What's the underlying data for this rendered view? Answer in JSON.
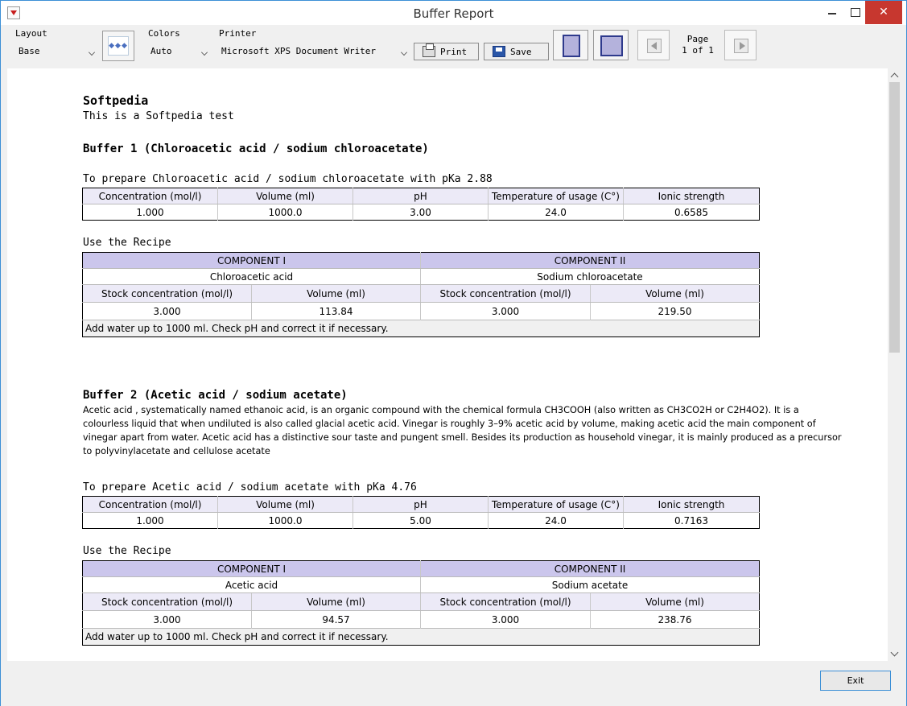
{
  "window": {
    "title": "Buffer Report"
  },
  "toolbar": {
    "layout_label": "Layout",
    "layout_value": "Base",
    "colors_label": "Colors",
    "colors_value": "Auto",
    "printer_label": "Printer",
    "printer_value": "Microsoft XPS Document Writer",
    "print_label": "Print",
    "save_label": "Save",
    "page_label": "Page",
    "page_value": "1 of 1"
  },
  "report": {
    "title": "Softpedia",
    "subtitle": "This is a Softpedia test",
    "buffers": [
      {
        "heading": "Buffer 1 (Chloroacetic acid / sodium chloroacetate)",
        "description": "",
        "prepare": "To prepare Chloroacetic acid / sodium chloroacetate with pKa 2.88",
        "prop_headers": [
          "Concentration (mol/l)",
          "Volume (ml)",
          "pH",
          "Temperature of usage (C°)",
          "Ionic strength"
        ],
        "prop_values": [
          "1.000",
          "1000.0",
          "3.00",
          "24.0",
          "0.6585"
        ],
        "recipe_label": "Use the Recipe",
        "component1": "COMPONENT I",
        "component2": "COMPONENT II",
        "comp1_name": "Chloroacetic acid",
        "comp2_name": "Sodium chloroacetate",
        "recipe_headers": [
          "Stock concentration (mol/l)",
          "Volume (ml)",
          "Stock concentration (mol/l)",
          "Volume (ml)"
        ],
        "recipe_values": [
          "3.000",
          "113.84",
          "3.000",
          "219.50"
        ],
        "note": "Add water up to 1000 ml. Check pH and correct it if necessary."
      },
      {
        "heading": "Buffer 2 (Acetic acid / sodium acetate)",
        "description": "Acetic acid , systematically named ethanoic acid, is an organic compound with the chemical formula CH3COOH (also written as CH3CO2H or C2H4O2). It is a colourless liquid that when undiluted is also called glacial acetic acid.  Vinegar is roughly 3–9% acetic acid by volume, making acetic acid the main component of vinegar apart from water. Acetic acid has a distinctive sour taste and pungent smell. Besides its production as household vinegar, it is mainly produced as a precursor to polyvinylacetate and cellulose acetate",
        "prepare": "To prepare Acetic acid / sodium acetate with pKa 4.76",
        "prop_headers": [
          "Concentration (mol/l)",
          "Volume (ml)",
          "pH",
          "Temperature of usage (C°)",
          "Ionic strength"
        ],
        "prop_values": [
          "1.000",
          "1000.0",
          "5.00",
          "24.0",
          "0.7163"
        ],
        "recipe_label": "Use the Recipe",
        "component1": "COMPONENT I",
        "component2": "COMPONENT II",
        "comp1_name": "Acetic acid",
        "comp2_name": "Sodium acetate",
        "recipe_headers": [
          "Stock concentration (mol/l)",
          "Volume (ml)",
          "Stock concentration (mol/l)",
          "Volume (ml)"
        ],
        "recipe_values": [
          "3.000",
          "94.57",
          "3.000",
          "238.76"
        ],
        "note": "Add water up to 1000 ml. Check pH and correct it if necessary."
      }
    ]
  },
  "footer": {
    "exit_label": "Exit"
  },
  "colors": {
    "component_header": "#cbc6ec",
    "props_header": "#eceaf7",
    "title_accent": "#3c8fd6",
    "close_button": "#c7372f"
  }
}
